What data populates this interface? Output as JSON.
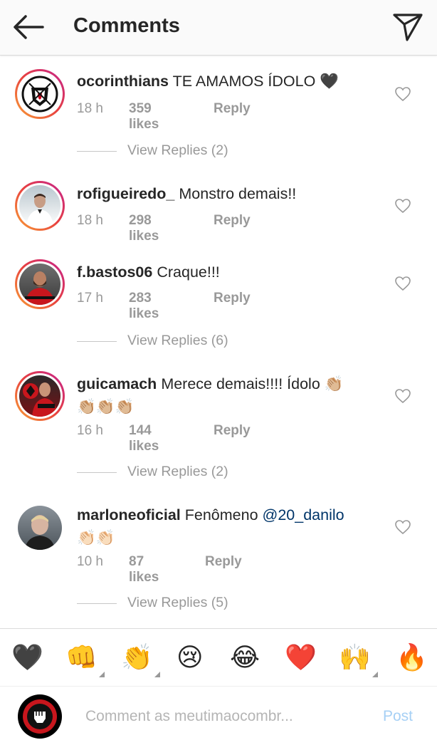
{
  "header": {
    "title": "Comments",
    "back_icon": "arrow-left-icon",
    "send_icon": "direct-send-icon"
  },
  "comments": [
    {
      "username": "ocorinthians",
      "text": "TE AMAMOS ÍDOLO 🖤",
      "time": "18 h",
      "likes": "359 likes",
      "reply": "Reply",
      "view_replies": "View Replies (2)",
      "avatar_ring": true
    },
    {
      "username": "rofigueiredo_",
      "text": "Monstro demais!!",
      "time": "18 h",
      "likes": "298 likes",
      "reply": "Reply",
      "avatar_ring": true
    },
    {
      "username": "f.bastos06",
      "text": "Craque!!!",
      "time": "17 h",
      "likes": "283 likes",
      "reply": "Reply",
      "view_replies": "View Replies (6)",
      "avatar_ring": true
    },
    {
      "username": "guicamach",
      "text": "Merece demais!!!! Ídolo 👏🏼",
      "text2": "👏🏼👏🏼👏🏼",
      "time": "16 h",
      "likes": "144 likes",
      "reply": "Reply",
      "view_replies": "View Replies (2)",
      "avatar_ring": true
    },
    {
      "username": "marloneoficial",
      "text": "Fenômeno ",
      "mention": "@20_danilo",
      "text2": "👏🏻👏🏻",
      "time": "10 h",
      "likes": "87 likes",
      "reply": "Reply",
      "view_replies": "View Replies (5)",
      "avatar_ring": false
    }
  ],
  "quick_emojis": [
    "🖤",
    "👊",
    "👏",
    "😢",
    "😂",
    "❤️",
    "🙌",
    "🔥"
  ],
  "input": {
    "placeholder": "Comment as meutimaocombr...",
    "post_label": "Post"
  }
}
